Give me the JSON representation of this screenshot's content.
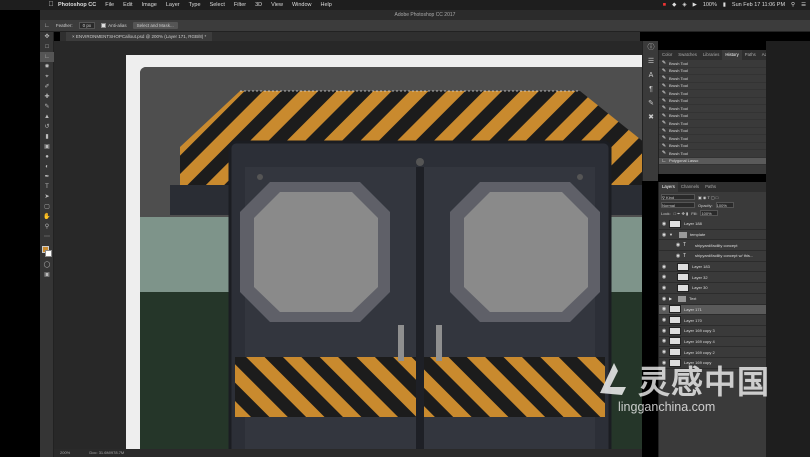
{
  "menubar": {
    "app_name": "Photoshop CC",
    "items": [
      "File",
      "Edit",
      "Image",
      "Layer",
      "Type",
      "Select",
      "Filter",
      "3D",
      "View",
      "Window",
      "Help"
    ],
    "battery": "100%",
    "clock": "Sun Feb 17  11:06 PM"
  },
  "window_title": "Adobe Photoshop CC 2017",
  "options_bar": {
    "feather_label": "Feather:",
    "feather_value": "0 px",
    "antialias_label": "Anti-alias",
    "select_mask_label": "Select and Mask..."
  },
  "document_tab": "ENVIRONMENTSHOPCallout.psd @ 200% (Layer 171, RGB/8) *",
  "status_bar": {
    "zoom": "200%",
    "doc_size": "Doc: 31.6M/978.7M"
  },
  "history_panel": {
    "tabs": [
      "Color",
      "Swatches",
      "Libraries",
      "History",
      "Paths",
      "Adjust"
    ],
    "active_tab": "History",
    "items": [
      "Brush Tool",
      "Brush Tool",
      "Brush Tool",
      "Brush Tool",
      "Brush Tool",
      "Brush Tool",
      "Brush Tool",
      "Brush Tool",
      "Brush Tool",
      "Brush Tool",
      "Brush Tool",
      "Brush Tool",
      "Brush Tool",
      "Polygonal Lasso"
    ]
  },
  "layers_panel": {
    "tabs": [
      "Layers",
      "Channels",
      "Paths"
    ],
    "active_tab": "Layers",
    "filter_label": "Kind",
    "blend_mode": "Normal",
    "opacity_label": "Opacity:",
    "opacity_value": "100%",
    "lock_label": "Lock:",
    "fill_label": "Fill:",
    "fill_value": "100%",
    "layers": [
      {
        "name": "Layer 188",
        "type": "layer"
      },
      {
        "name": "template",
        "type": "group"
      },
      {
        "name": "shipyard/facility concept",
        "type": "text"
      },
      {
        "name": "shipyard/facility concept w/ this...",
        "type": "text"
      },
      {
        "name": "Layer 183",
        "type": "layer"
      },
      {
        "name": "Layer 32",
        "type": "layer"
      },
      {
        "name": "Layer 30",
        "type": "layer"
      },
      {
        "name": "Text",
        "type": "group"
      },
      {
        "name": "Layer 171",
        "type": "layer",
        "selected": true
      },
      {
        "name": "Layer 170",
        "type": "layer"
      },
      {
        "name": "Layer 169 copy 3",
        "type": "layer"
      },
      {
        "name": "Layer 169 copy 4",
        "type": "layer"
      },
      {
        "name": "Layer 169 copy 2",
        "type": "layer"
      },
      {
        "name": "Layer 169 copy",
        "type": "layer"
      }
    ]
  },
  "watermark": {
    "text": "灵感中国",
    "url": "lingganchina.com"
  },
  "colors": {
    "hazard_orange": "#c98a2e",
    "door_dark": "#2c2f37",
    "window_gray": "#8a8a8a",
    "wall_green": "#7e948a",
    "grass_green": "#2a3d2e"
  }
}
